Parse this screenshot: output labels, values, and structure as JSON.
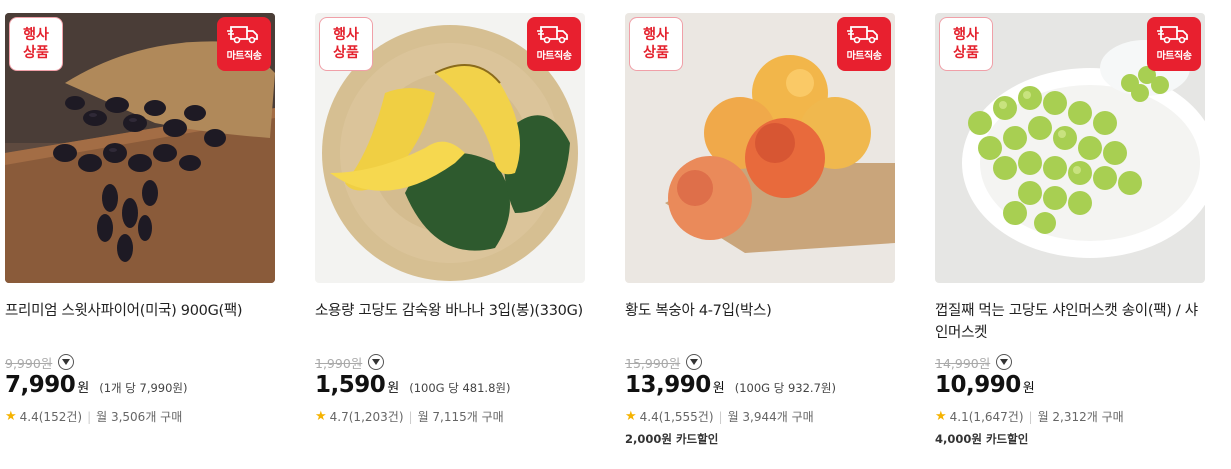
{
  "products": [
    {
      "event_badge_line1": "행사",
      "event_badge_line2": "상품",
      "mart_badge_label": "마트직송",
      "title": "프리미엄 스윗사파이어(미국) 900G(팩)",
      "original_price": "9,990원",
      "price": "7,990",
      "price_unit": "원",
      "unit_price": "(1개 당 7,990원)",
      "rating": "4.4",
      "review_count": "(152건)",
      "monthly_purchases": "월 3,506개 구매",
      "card_discount": ""
    },
    {
      "event_badge_line1": "행사",
      "event_badge_line2": "상품",
      "mart_badge_label": "마트직송",
      "title": "소용량 고당도 감숙왕 바나나 3입(봉)(330G)",
      "original_price": "1,990원",
      "price": "1,590",
      "price_unit": "원",
      "unit_price": "(100G 당 481.8원)",
      "rating": "4.7",
      "review_count": "(1,203건)",
      "monthly_purchases": "월 7,115개 구매",
      "card_discount": ""
    },
    {
      "event_badge_line1": "행사",
      "event_badge_line2": "상품",
      "mart_badge_label": "마트직송",
      "title": "황도 복숭아 4-7입(박스)",
      "original_price": "15,990원",
      "price": "13,990",
      "price_unit": "원",
      "unit_price": "(100G 당 932.7원)",
      "rating": "4.4",
      "review_count": "(1,555건)",
      "monthly_purchases": "월 3,944개 구매",
      "card_discount": "2,000원 카드할인"
    },
    {
      "event_badge_line1": "행사",
      "event_badge_line2": "상품",
      "mart_badge_label": "마트직송",
      "title": "껍질째 먹는 고당도 샤인머스캣 송이(팩) / 샤인머스켓",
      "original_price": "14,990원",
      "price": "10,990",
      "price_unit": "원",
      "unit_price": "",
      "rating": "4.1",
      "review_count": "(1,647건)",
      "monthly_purchases": "월 2,312개 구매",
      "card_discount": "4,000원 카드할인"
    }
  ],
  "colors": {
    "accent_red": "#e8202f",
    "star": "#f5b301"
  },
  "icons": {
    "delivery": "truck-icon",
    "expand": "chevron-down-icon",
    "rating": "star-icon"
  }
}
